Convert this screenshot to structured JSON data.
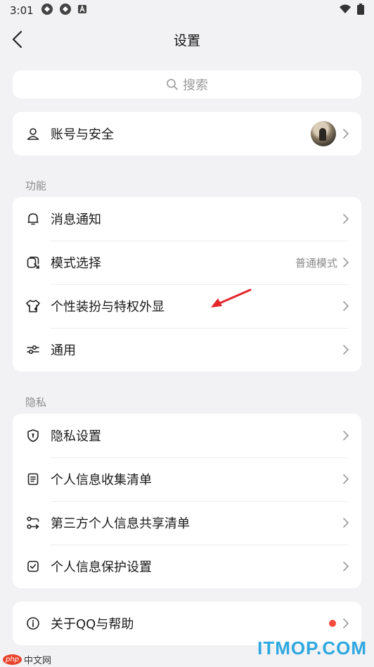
{
  "status_bar": {
    "time": "3:01"
  },
  "nav": {
    "title": "设置"
  },
  "search": {
    "placeholder": "搜索"
  },
  "account": {
    "label": "账号与安全"
  },
  "section_features": {
    "title": "功能",
    "items": [
      {
        "label": "消息通知",
        "icon": "bell-icon"
      },
      {
        "label": "模式选择",
        "icon": "mode-icon",
        "value": "普通模式"
      },
      {
        "label": "个性装扮与特权外显",
        "icon": "tshirt-icon"
      },
      {
        "label": "通用",
        "icon": "sliders-icon"
      }
    ]
  },
  "section_privacy": {
    "title": "隐私",
    "items": [
      {
        "label": "隐私设置",
        "icon": "shield-icon"
      },
      {
        "label": "个人信息收集清单",
        "icon": "document-icon"
      },
      {
        "label": "第三方个人信息共享清单",
        "icon": "share-icon"
      },
      {
        "label": "个人信息保护设置",
        "icon": "checkbox-icon"
      }
    ]
  },
  "about": {
    "label": "关于QQ与帮助",
    "icon": "info-icon"
  },
  "watermarks": {
    "left_text": "中文网",
    "left_badge": "php",
    "right_text": "ITMOP.COM"
  },
  "colors": {
    "background": "#f2f2f4",
    "card": "#ffffff",
    "annotation_arrow": "#e4262b",
    "notification_dot": "#f44a3d"
  }
}
